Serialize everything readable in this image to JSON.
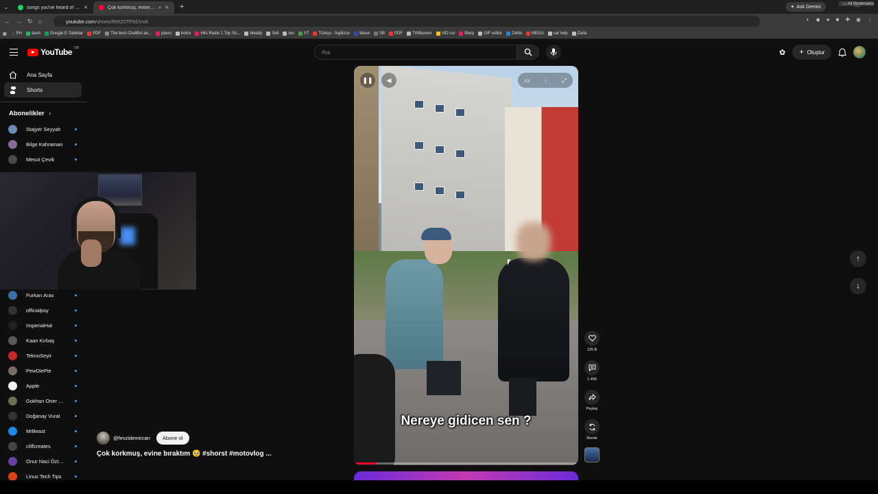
{
  "browser": {
    "tabs": [
      {
        "title": "songs you've heard of but don't",
        "color": "#1ed760",
        "active": false
      },
      {
        "title": "Çok korkmuş, evine bıraktı",
        "color": "#ff0033",
        "active": true
      }
    ],
    "gemini_label": "Ask Gemini",
    "url_host": "youtube.com",
    "url_path": "/shorts/RMZ0TF6DVv8",
    "bookmarks": [
      {
        "label": "PH",
        "color": "#444"
      },
      {
        "label": "dash",
        "color": "#1db954"
      },
      {
        "label": "Google E-Tablolar",
        "color": "#0f9d58"
      },
      {
        "label": "PDF",
        "color": "#e53935"
      },
      {
        "label": "The best ChatBot an...",
        "color": "#888"
      },
      {
        "label": "piano",
        "color": "#e91e63"
      },
      {
        "label": "botnx",
        "color": "#bbb"
      },
      {
        "label": "Hits Radio 1 Top So...",
        "color": "#e91e63"
      },
      {
        "label": "Metafy",
        "color": "#bbb"
      },
      {
        "label": "Sell",
        "color": "#bbb"
      },
      {
        "label": "rev",
        "color": "#bbb"
      },
      {
        "label": "XT",
        "color": "#43a047"
      },
      {
        "label": "Türkçe - İngilizce",
        "color": "#e53935"
      },
      {
        "label": "Wave",
        "color": "#3949ab"
      },
      {
        "label": "SB",
        "color": "#777"
      },
      {
        "label": "PDF",
        "color": "#e53935"
      },
      {
        "label": "TWBanner",
        "color": "#bbb"
      },
      {
        "label": "VID cut",
        "color": "#fbc02d"
      },
      {
        "label": "Bierp",
        "color": "#e91e63"
      },
      {
        "label": "GIF editor",
        "color": "#bbb"
      },
      {
        "label": "Zettle",
        "color": "#1e88e5"
      },
      {
        "label": "MEGA",
        "color": "#e53935"
      },
      {
        "label": "vat help",
        "color": "#bbb"
      },
      {
        "label": "Zarla",
        "color": "#bbb"
      }
    ],
    "all_bookmarks_label": "All Bookmarks"
  },
  "header": {
    "logo_text": "YouTube",
    "logo_country": "GB",
    "search_placeholder": "Ara",
    "create_label": "Oluştur"
  },
  "sidebar": {
    "items": [
      {
        "label": "Ana Sayfa",
        "icon": "home-icon",
        "active": false
      },
      {
        "label": "Shorts",
        "icon": "shorts-icon",
        "active": true
      }
    ],
    "subs_title": "Abonelikler",
    "subscriptions_top": [
      {
        "label": "Stajyer Seyyah",
        "color": "#6a8caf"
      },
      {
        "label": "Bilge Kahraman",
        "color": "#8a6a9a"
      },
      {
        "label": "Mesut Çevik",
        "color": "#4a4a4a"
      }
    ],
    "subscriptions_bottom": [
      {
        "label": "Furkan Aras",
        "color": "#3b6ea5"
      },
      {
        "label": "officialpsy",
        "color": "#333333"
      },
      {
        "label": "ImperialHal",
        "color": "#222222"
      },
      {
        "label": "Kaan Kırbaş",
        "color": "#5a5a5a"
      },
      {
        "label": "TeknoSeyir",
        "color": "#c62828"
      },
      {
        "label": "PewDiePie",
        "color": "#7a6a6a"
      },
      {
        "label": "Apple",
        "color": "#f1f1f1"
      },
      {
        "label": "Gokhan Oner Kick",
        "color": "#6e6e50"
      },
      {
        "label": "Doğanay Vural",
        "color": "#333333"
      },
      {
        "label": "MrBeast",
        "color": "#1e88e5"
      },
      {
        "label": "cliffcreates",
        "color": "#444444"
      },
      {
        "label": "Onur Naci Öztürk...",
        "color": "#6a3fa0"
      },
      {
        "label": "Linus Tech Tips",
        "color": "#d84315"
      }
    ]
  },
  "video": {
    "caption": "Nereye gidicen sen ?",
    "progress": 0.1
  },
  "actions": {
    "like_count": "125 B",
    "comment_count": "1.456",
    "share_label": "Paylaş",
    "remix_label": "Remix"
  },
  "channel": {
    "handle": "@fevzidemircan",
    "subscribe_label": "Abone ol",
    "title": "Çok korkmuş, evine bıraktım 🥹 #shorst #motovlog ..."
  }
}
